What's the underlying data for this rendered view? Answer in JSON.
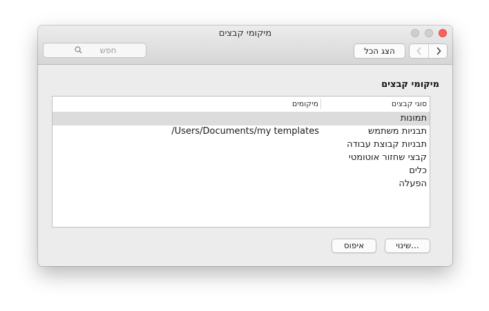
{
  "window": {
    "title": "מיקומי קבצים"
  },
  "toolbar": {
    "search_placeholder": "חפש",
    "show_all_label": "הצג הכל",
    "back_icon": "chevron-left-icon",
    "forward_icon": "chevron-right-icon"
  },
  "section": {
    "title": "מיקומי קבצים"
  },
  "table": {
    "columns": [
      "סוגי קבצים",
      "מיקומים"
    ],
    "rows": [
      {
        "type": "תמונות",
        "location": ""
      },
      {
        "type": "תבניות משתמש",
        "location": "/Users/Documents/my templates"
      },
      {
        "type": "תבניות קבוצת עבודה",
        "location": ""
      },
      {
        "type": "קבצי שחזור אוטומטי",
        "location": ""
      },
      {
        "type": "כלים",
        "location": ""
      },
      {
        "type": "הפעלה",
        "location": ""
      }
    ],
    "selected_index": 0
  },
  "buttons": {
    "reset": "איפוס",
    "modify": "שינוי..."
  },
  "colors": {
    "close": "#fc605c",
    "selection": "#dcdcdc"
  }
}
